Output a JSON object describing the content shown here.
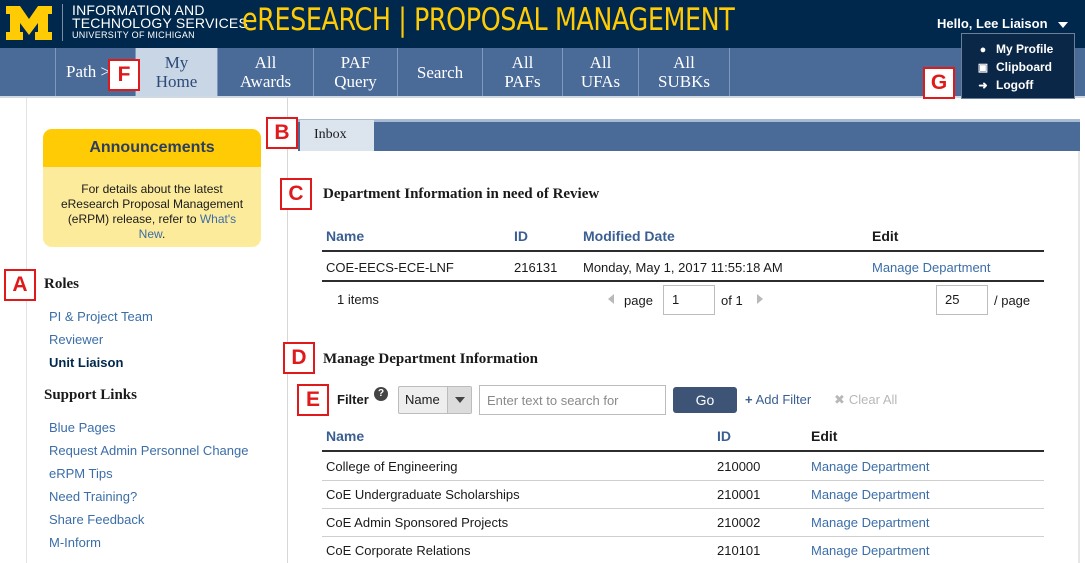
{
  "header": {
    "org_line1": "INFORMATION AND",
    "org_line2": "TECHNOLOGY SERVICES",
    "org_line3": "UNIVERSITY OF MICHIGAN",
    "app_title": "eRESEARCH | PROPOSAL MANAGEMENT",
    "greeting": "Hello, Lee Liaison"
  },
  "colors": {
    "header_bg": "#00274c",
    "nav_bg": "#4a6a97",
    "brand_yellow": "#ffcb05",
    "announcement_bg": "#fdeb9c",
    "link": "#3b6ea8",
    "callout_red": "#e01a1a"
  },
  "user_menu": {
    "items": [
      {
        "icon": "person-icon",
        "label": "My Profile"
      },
      {
        "icon": "clipboard-icon",
        "label": "Clipboard"
      },
      {
        "icon": "logoff-icon",
        "label": "Logoff"
      }
    ]
  },
  "nav": {
    "path_label": "Path",
    "items": [
      {
        "line1": "My",
        "line2": "Home",
        "active": true
      },
      {
        "line1": "All",
        "line2": "Awards"
      },
      {
        "line1": "PAF",
        "line2": "Query"
      },
      {
        "line1": "Search",
        "line2": ""
      },
      {
        "line1": "All",
        "line2": "PAFs"
      },
      {
        "line1": "All",
        "line2": "UFAs"
      },
      {
        "line1": "All",
        "line2": "SUBKs"
      }
    ]
  },
  "markers": {
    "a": "A",
    "b": "B",
    "c": "C",
    "d": "D",
    "e": "E",
    "f": "F",
    "g": "G"
  },
  "announcements": {
    "title": "Announcements",
    "text_before": "For details about the latest eResearch Proposal Management (eRPM) release, refer to ",
    "link_text": "What's New",
    "text_after": "."
  },
  "sidebar": {
    "roles_heading": "Roles",
    "roles": [
      "PI & Project Team",
      "Reviewer",
      "Unit Liaison"
    ],
    "current_role": "Unit Liaison",
    "support_heading": "Support Links",
    "support_links": [
      "Blue Pages",
      "Request Admin Personnel Change",
      "eRPM Tips",
      "Need Training?",
      "Share Feedback",
      "M-Inform"
    ]
  },
  "tabs": {
    "inbox": "Inbox"
  },
  "review_section": {
    "title": "Department Information in need of Review",
    "columns": [
      "Name",
      "ID",
      "Modified Date",
      "Edit"
    ],
    "rows": [
      {
        "name": "COE-EECS-ECE-LNF",
        "id": "216131",
        "modified": "Monday, May 1, 2017 11:55:18 AM",
        "edit": "Manage Department"
      }
    ],
    "pager": {
      "items_text": "1 items",
      "page_label": "page",
      "page_value": "1",
      "of_text": "of 1",
      "per_page_value": "25",
      "per_page_label": "/ page"
    }
  },
  "manage_section": {
    "title": "Manage Department Information",
    "filter": {
      "label": "Filter",
      "help": "?",
      "field_value": "Name",
      "search_placeholder": "Enter text to search for",
      "go_label": "Go",
      "add_filter_label": "Add Filter",
      "clear_all_label": "Clear All"
    },
    "columns": [
      "Name",
      "ID",
      "Edit"
    ],
    "rows": [
      {
        "name": "College of Engineering",
        "id": "210000",
        "edit": "Manage Department"
      },
      {
        "name": "CoE Undergraduate Scholarships",
        "id": "210001",
        "edit": "Manage Department"
      },
      {
        "name": "CoE Admin Sponsored Projects",
        "id": "210002",
        "edit": "Manage Department"
      },
      {
        "name": "CoE Corporate Relations",
        "id": "210101",
        "edit": "Manage Department"
      }
    ]
  }
}
